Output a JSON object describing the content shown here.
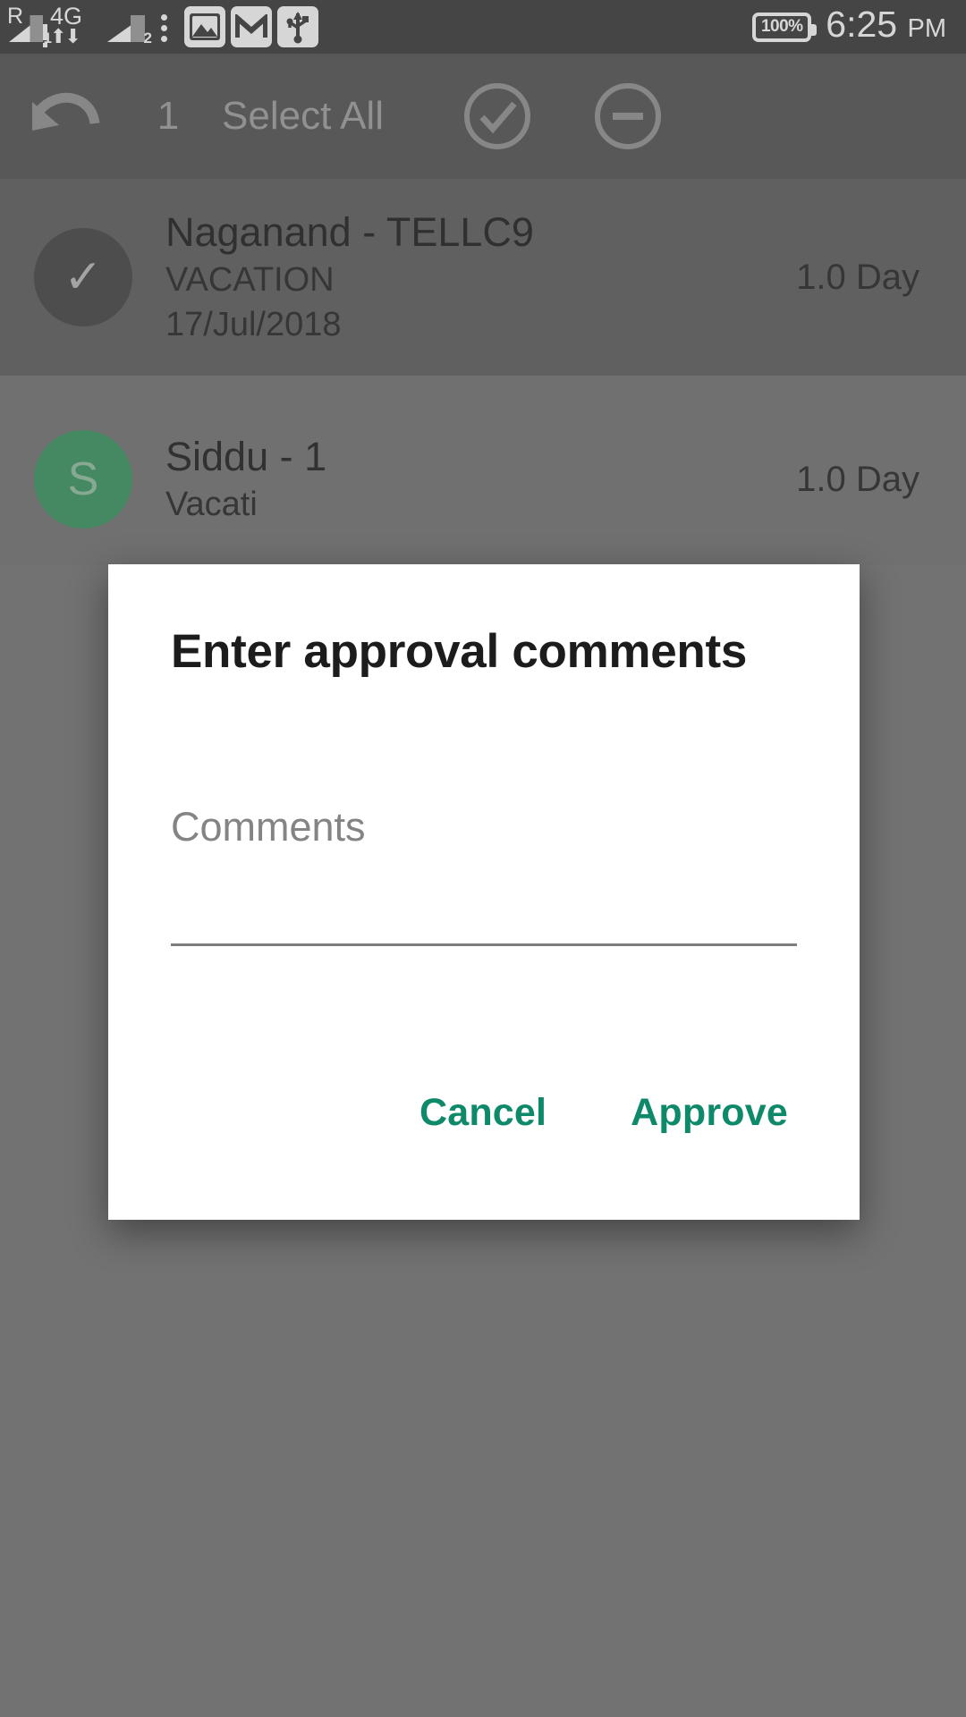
{
  "status_bar": {
    "roaming_label": "R",
    "network_type": "4G",
    "sim1_label": "1",
    "sim2_label": "2",
    "icons": [
      "signal-sim1-icon",
      "network-4g-icon",
      "signal-sim2-icon",
      "more-vert-icon",
      "gallery-icon",
      "gmail-icon",
      "usb-icon"
    ],
    "battery_percent": "100%",
    "time": "6:25",
    "ampm": "PM"
  },
  "toolbar": {
    "back_icon": "undo-arrow-icon",
    "selected_count": "1",
    "select_all_label": "Select All",
    "approve_icon": "check-circle-icon",
    "reject_icon": "minus-circle-icon"
  },
  "list": {
    "rows": [
      {
        "avatar_letter": "✓",
        "selected": true,
        "name": "Naganand - TELLC9",
        "leave_type": "VACATION",
        "date": "17/Jul/2018",
        "duration": "1.0 Day"
      },
      {
        "avatar_letter": "S",
        "selected": false,
        "name": "Siddu - 1",
        "leave_type": "Vacati",
        "date": "",
        "duration": "1.0 Day"
      }
    ]
  },
  "dialog": {
    "title": "Enter approval comments",
    "comments_placeholder": "Comments",
    "comments_value": "",
    "cancel_label": "Cancel",
    "approve_label": "Approve"
  },
  "colors": {
    "accent_teal": "#0e8a6b",
    "avatar_green": "#2f9159",
    "status_bar_bg": "#303030",
    "toolbar_bg": "#4b4b4b",
    "scrim": "#727272"
  }
}
